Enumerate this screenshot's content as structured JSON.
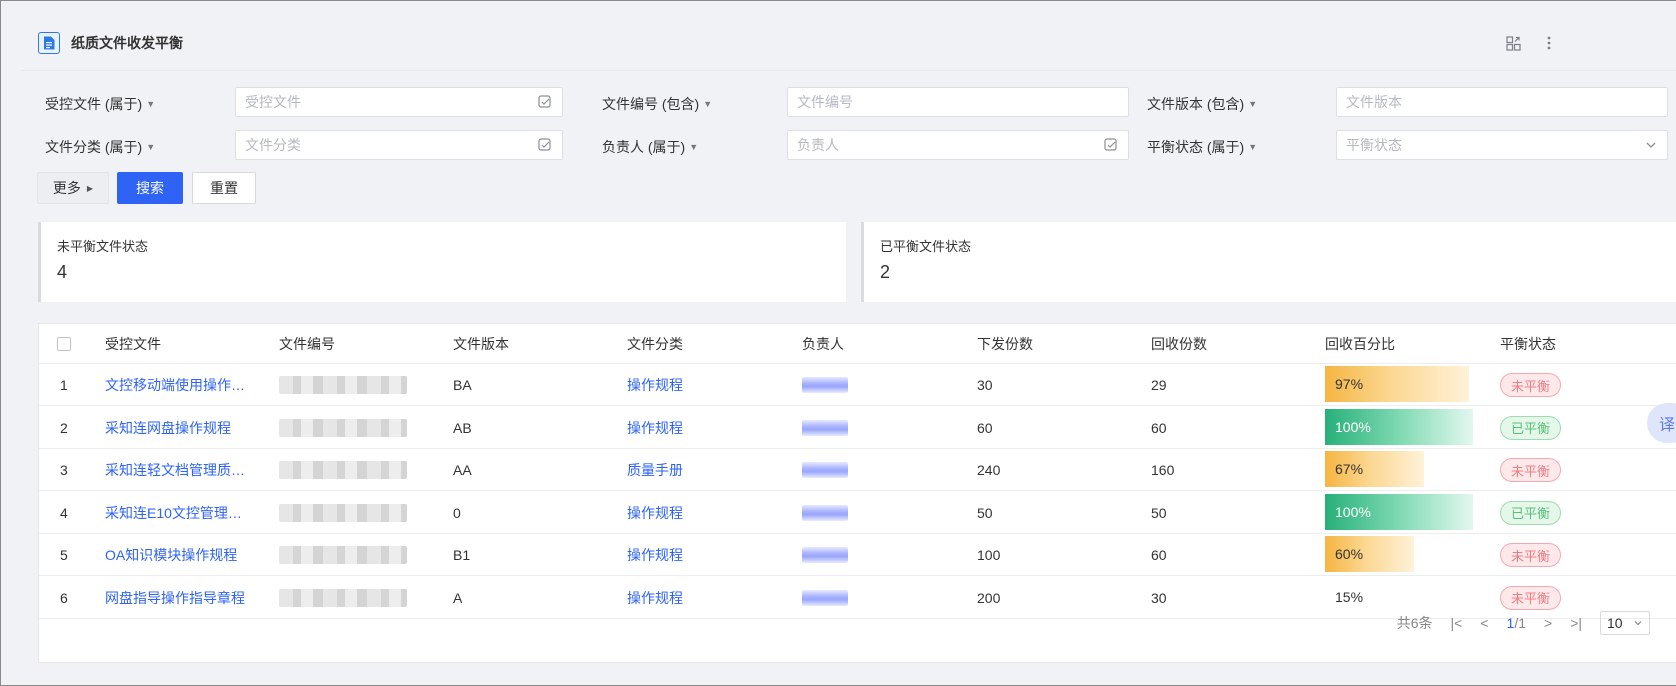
{
  "header": {
    "title": "纸质文件收发平衡"
  },
  "filters": {
    "row1": [
      {
        "label": "受控文件 (属于)",
        "placeholder": "受控文件"
      },
      {
        "label": "文件编号 (包含)",
        "placeholder": "文件编号"
      },
      {
        "label": "文件版本 (包含)",
        "placeholder": "文件版本"
      }
    ],
    "row2": [
      {
        "label": "文件分类 (属于)",
        "placeholder": "文件分类"
      },
      {
        "label": "负责人 (属于)",
        "placeholder": "负责人"
      },
      {
        "label": "平衡状态 (属于)",
        "placeholder": "平衡状态"
      }
    ]
  },
  "actions": {
    "more": "更多",
    "search": "搜索",
    "reset": "重置"
  },
  "stats": [
    {
      "label": "未平衡文件状态",
      "value": "4"
    },
    {
      "label": "已平衡文件状态",
      "value": "2"
    }
  ],
  "table": {
    "columns": [
      "受控文件",
      "文件编号",
      "文件版本",
      "文件分类",
      "负责人",
      "下发份数",
      "回收份数",
      "回收百分比",
      "平衡状态"
    ],
    "rows": [
      {
        "index": "1",
        "file": "文控移动端使用操作…",
        "version": "BA",
        "category": "操作规程",
        "issued": "30",
        "recovered": "29",
        "percent": "97%",
        "percent_value": 97,
        "status": "未平衡",
        "status_type": "red"
      },
      {
        "index": "2",
        "file": "采知连网盘操作规程",
        "version": "AB",
        "category": "操作规程",
        "issued": "60",
        "recovered": "60",
        "percent": "100%",
        "percent_value": 100,
        "status": "已平衡",
        "status_type": "green"
      },
      {
        "index": "3",
        "file": "采知连轻文档管理质…",
        "version": "AA",
        "category": "质量手册",
        "issued": "240",
        "recovered": "160",
        "percent": "67%",
        "percent_value": 67,
        "status": "未平衡",
        "status_type": "red"
      },
      {
        "index": "4",
        "file": "采知连E10文控管理…",
        "version": "0",
        "category": "操作规程",
        "issued": "50",
        "recovered": "50",
        "percent": "100%",
        "percent_value": 100,
        "status": "已平衡",
        "status_type": "green"
      },
      {
        "index": "5",
        "file": "OA知识模块操作规程",
        "version": "B1",
        "category": "操作规程",
        "issued": "100",
        "recovered": "60",
        "percent": "60%",
        "percent_value": 60,
        "status": "未平衡",
        "status_type": "red"
      },
      {
        "index": "6",
        "file": "网盘指导操作指导章程",
        "version": "A",
        "category": "操作规程",
        "issued": "200",
        "recovered": "30",
        "percent": "15%",
        "percent_value": 15,
        "status": "未平衡",
        "status_type": "red"
      }
    ]
  },
  "pagination": {
    "total": "共6条",
    "page": "1",
    "pages": "1",
    "page_size": "10"
  },
  "floating": {
    "translate": "译"
  },
  "colors": {
    "primary": "#2e63f6",
    "link": "#2e63f6",
    "unbalanced": "#f07b84",
    "balanced": "#59c07b"
  }
}
